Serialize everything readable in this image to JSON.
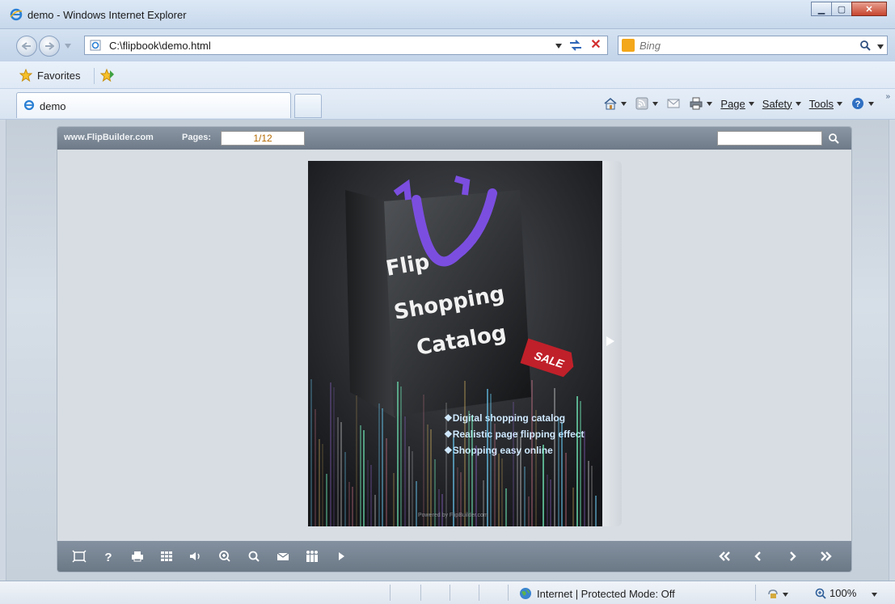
{
  "window": {
    "title": "demo - Windows Internet Explorer"
  },
  "address": {
    "url": "C:\\flipbook\\demo.html"
  },
  "search": {
    "placeholder": "Bing"
  },
  "favorites": {
    "label": "Favorites"
  },
  "tab": {
    "label": "demo"
  },
  "commands": {
    "page": "Page",
    "safety": "Safety",
    "tools": "Tools"
  },
  "viewer": {
    "site": "www.FlipBuilder.com",
    "pages_label": "Pages:",
    "page_value": "1/12",
    "tools": [
      "fit-to-screen-icon",
      "help-icon",
      "print-icon",
      "thumbnails-icon",
      "sound-icon",
      "zoom-in-icon",
      "search-icon",
      "email-icon",
      "social-share-icon",
      "autoplay-icon"
    ],
    "nav": [
      "first-page-icon",
      "previous-page-icon",
      "next-page-icon",
      "last-page-icon"
    ]
  },
  "book": {
    "title_lines": [
      "Flip",
      "Shopping",
      "Catalog"
    ],
    "tag": "SALE",
    "bullets": [
      "❖Digital shopping catalog",
      "❖Realistic page flipping effect",
      "❖Shopping easy online"
    ],
    "powered": "Powered by FlipBuilder.com"
  },
  "status": {
    "zone": "Internet | Protected Mode: Off",
    "zoom": "100%"
  },
  "colors": {
    "accent": "#7b4ee0",
    "tag": "#c0202a"
  }
}
